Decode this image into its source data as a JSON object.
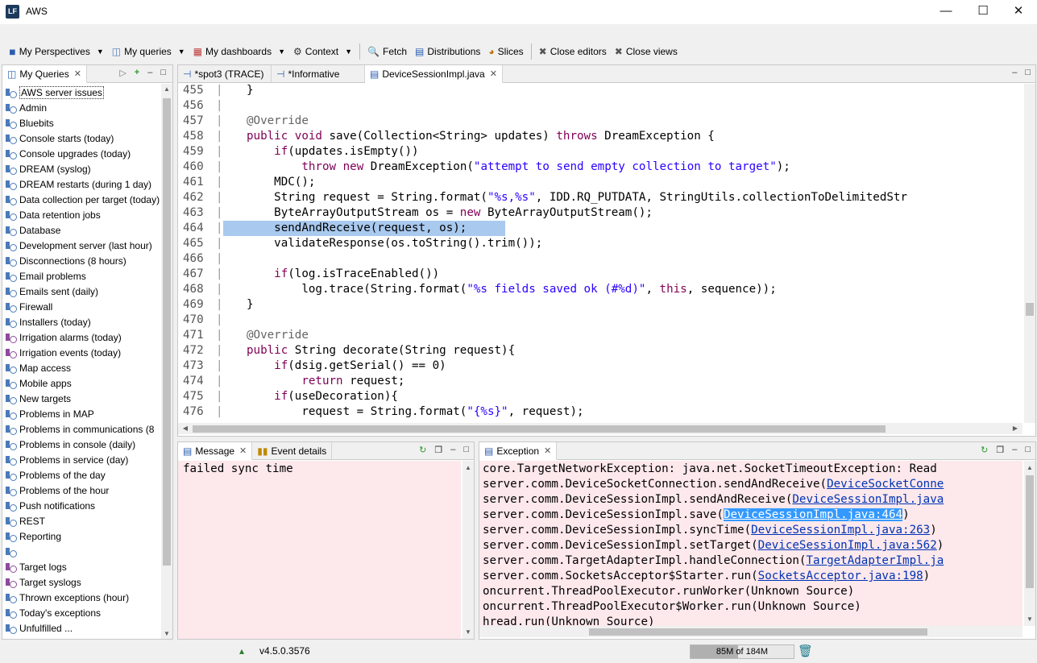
{
  "window": {
    "title": "AWS",
    "app_icon": "LF"
  },
  "toolbar": {
    "items": [
      {
        "label": "My Perspectives",
        "icon": "perspective-icon",
        "dropdown": true
      },
      {
        "label": "My queries",
        "icon": "query-icon",
        "dropdown": true
      },
      {
        "label": "My dashboards",
        "icon": "dashboard-icon",
        "dropdown": true
      },
      {
        "label": "Context",
        "icon": "context-icon",
        "dropdown": true
      },
      {
        "label": "Fetch",
        "icon": "search-icon",
        "dropdown": false
      },
      {
        "label": "Distributions",
        "icon": "bar-chart-icon",
        "dropdown": false
      },
      {
        "label": "Slices",
        "icon": "pie-chart-icon",
        "dropdown": false
      },
      {
        "label": "Close editors",
        "icon": "close-editors-icon",
        "dropdown": false
      },
      {
        "label": "Close views",
        "icon": "close-views-icon",
        "dropdown": false
      }
    ]
  },
  "queries_panel": {
    "tab_label": "My Queries",
    "items": [
      "AWS server issues",
      "Admin",
      "Bluebits",
      "Console starts (today)",
      "Console upgrades (today)",
      "DREAM (syslog)",
      "DREAM restarts (during 1 day)",
      "Data collection per target (today)",
      "Data retention jobs",
      "Database",
      "Development server (last hour)",
      "Disconnections (8 hours)",
      "Email problems",
      "Emails sent (daily)",
      "Firewall",
      "Installers (today)",
      "Irrigation alarms (today)",
      "Irrigation events (today)",
      "Map access",
      "Mobile apps",
      "New targets",
      "Problems in MAP",
      "Problems in communications (8",
      "Problems in console (daily)",
      "Problems in service (day)",
      "Problems of the day",
      "Problems of the hour",
      "Push notifications",
      "REST",
      "Reporting",
      "",
      "Target logs",
      "Target syslogs",
      "Thrown exceptions (hour)",
      "Today's exceptions",
      "Unfulfilled ..."
    ]
  },
  "editor": {
    "tabs": [
      {
        "label": "*spot3 (TRACE)",
        "active": false
      },
      {
        "label": "*Informative",
        "active": false
      },
      {
        "label": "DeviceSessionImpl.java",
        "active": true
      }
    ],
    "lines": [
      {
        "n": "455",
        "t": "}"
      },
      {
        "n": "456",
        "t": ""
      },
      {
        "n": "457",
        "t": "@Override"
      },
      {
        "n": "458",
        "t": "public void save(Collection<String> updates) throws DreamException {"
      },
      {
        "n": "459",
        "t": "    if(updates.isEmpty())"
      },
      {
        "n": "460",
        "t": "        throw new DreamException(\"attempt to send empty collection to target\");"
      },
      {
        "n": "461",
        "t": "    MDC();"
      },
      {
        "n": "462",
        "t": "    String request = String.format(\"%s,%s\", IDD.RQ_PUTDATA, StringUtils.collectionToDelimitedStr"
      },
      {
        "n": "463",
        "t": "    ByteArrayOutputStream os = new ByteArrayOutputStream();"
      },
      {
        "n": "464",
        "t": "    sendAndReceive(request, os);"
      },
      {
        "n": "465",
        "t": "    validateResponse(os.toString().trim());"
      },
      {
        "n": "466",
        "t": ""
      },
      {
        "n": "467",
        "t": "    if(log.isTraceEnabled())"
      },
      {
        "n": "468",
        "t": "        log.trace(String.format(\"%s fields saved ok (#%d)\", this, sequence));"
      },
      {
        "n": "469",
        "t": "}"
      },
      {
        "n": "470",
        "t": ""
      },
      {
        "n": "471",
        "t": "@Override"
      },
      {
        "n": "472",
        "t": "public String decorate(String request){"
      },
      {
        "n": "473",
        "t": "    if(dsig.getSerial() == 0)"
      },
      {
        "n": "474",
        "t": "        return request;"
      },
      {
        "n": "475",
        "t": "    if(useDecoration){"
      },
      {
        "n": "476",
        "t": "        request = String.format(\"{%s}\", request);"
      }
    ],
    "highlighted_line": "464"
  },
  "message_panel": {
    "tabs": [
      "Message",
      "Event details"
    ],
    "text": "failed sync time"
  },
  "exception_panel": {
    "tab_label": "Exception",
    "lines": [
      {
        "pre": "core.TargetNetworkException: java.net.SocketTimeoutException: Read",
        "link": "",
        "post": ""
      },
      {
        "pre": "server.comm.DeviceSocketConnection.sendAndReceive(",
        "link": "DeviceSocketConne",
        "post": ""
      },
      {
        "pre": "server.comm.DeviceSessionImpl.sendAndReceive(",
        "link": "DeviceSessionImpl.java",
        "post": ""
      },
      {
        "pre": "server.comm.DeviceSessionImpl.save(",
        "link": "DeviceSessionImpl.java:464",
        "post": ")",
        "selected": true
      },
      {
        "pre": "server.comm.DeviceSessionImpl.syncTime(",
        "link": "DeviceSessionImpl.java:263",
        "post": ")"
      },
      {
        "pre": "server.comm.DeviceSessionImpl.setTarget(",
        "link": "DeviceSessionImpl.java:562",
        "post": ")"
      },
      {
        "pre": "server.comm.TargetAdapterImpl.handleConnection(",
        "link": "TargetAdapterImpl.ja",
        "post": ""
      },
      {
        "pre": "server.comm.SocketsAcceptor$Starter.run(",
        "link": "SocketsAcceptor.java:198",
        "post": ")"
      },
      {
        "pre": "oncurrent.ThreadPoolExecutor.runWorker(Unknown Source)",
        "link": "",
        "post": ""
      },
      {
        "pre": "oncurrent.ThreadPoolExecutor$Worker.run(Unknown Source)",
        "link": "",
        "post": ""
      },
      {
        "pre": "hread.run(Unknown Source)",
        "link": "",
        "post": ""
      }
    ]
  },
  "status": {
    "version": "v4.5.0.3576",
    "heap": "85M of 184M",
    "heap_fraction": 0.462
  }
}
